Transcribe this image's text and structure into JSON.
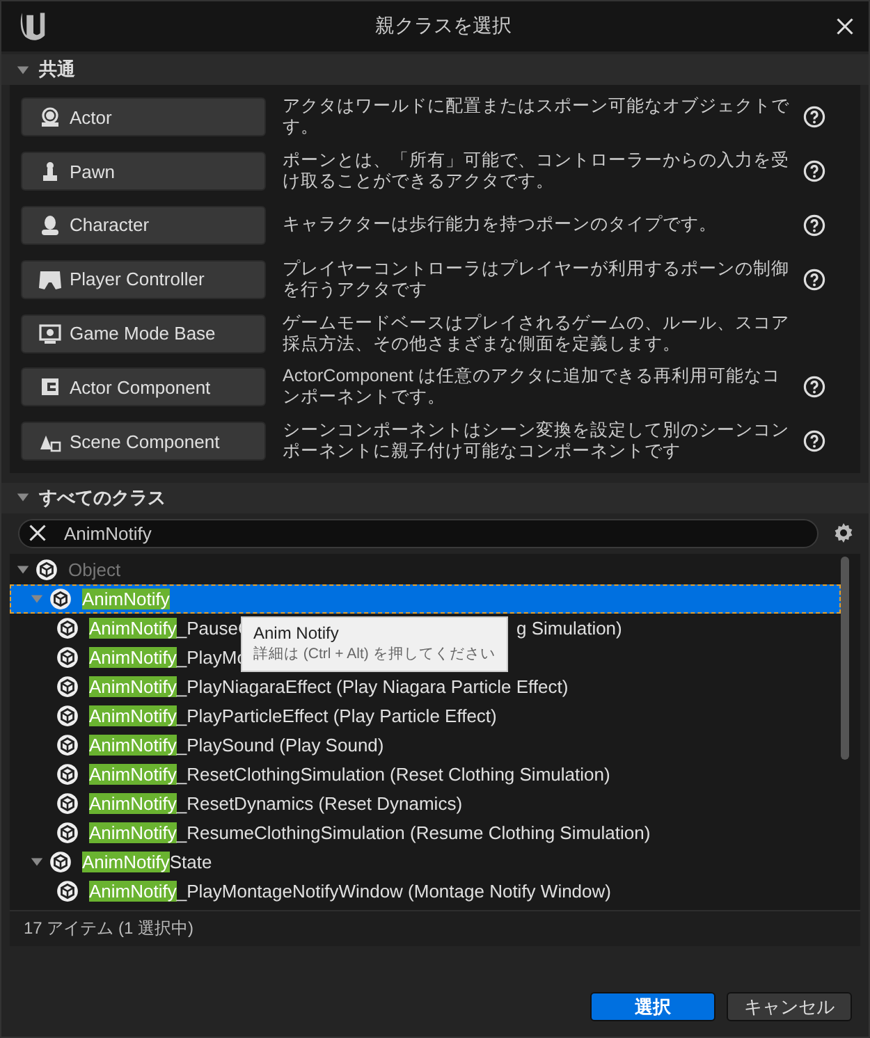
{
  "window": {
    "title": "親クラスを選択"
  },
  "common_section": {
    "title": "共通",
    "expanded": true,
    "classes": [
      {
        "label": "Actor",
        "description": "アクタはワールドに配置またはスポーン可能なオブジェクトです。",
        "help": true
      },
      {
        "label": "Pawn",
        "description": "ポーンとは、「所有」可能で、コントローラーからの入力を受け取ることができるアクタです。",
        "help": true
      },
      {
        "label": "Character",
        "description": "キャラクターは歩行能力を持つポーンのタイプです。",
        "help": true
      },
      {
        "label": "Player Controller",
        "description": "プレイヤーコントローラはプレイヤーが利用するポーンの制御を行うアクタです",
        "help": true
      },
      {
        "label": "Game Mode Base",
        "description": "ゲームモードベースはプレイされるゲームの、ルール、スコア採点方法、その他さまざまな側面を定義します。",
        "help": false
      },
      {
        "label": "Actor Component",
        "description": "ActorComponent は任意のアクタに追加できる再利用可能なコンポーネントです。",
        "help": true
      },
      {
        "label": "Scene Component",
        "description": "シーンコンポーネントはシーン変換を設定して別のシーンコンポーネントに親子付け可能なコンポーネントです",
        "help": true
      }
    ]
  },
  "all_classes_section": {
    "title": "すべてのクラス",
    "expanded": true,
    "search": {
      "value": "AnimNotify"
    },
    "tree": [
      {
        "label": "Object",
        "dimmed": true,
        "expanded": true,
        "selected": false,
        "children": [
          {
            "match": "AnimNotify",
            "dimmed": false,
            "expanded": true,
            "selected": true,
            "children": [
              {
                "match": "AnimNotify",
                "rest": "_PauseC",
                "tail": "g Simulation)",
                "dimmed": false,
                "selected": false
              },
              {
                "match": "AnimNotify",
                "rest": "_PlayMo",
                "dimmed": false,
                "selected": false
              },
              {
                "match": "AnimNotify",
                "rest": "_PlayNiagaraEffect (Play Niagara Particle Effect)",
                "dimmed": false,
                "selected": false
              },
              {
                "match": "AnimNotify",
                "rest": "_PlayParticleEffect (Play Particle Effect)",
                "dimmed": false,
                "selected": false
              },
              {
                "match": "AnimNotify",
                "rest": "_PlaySound (Play Sound)",
                "dimmed": false,
                "selected": false
              },
              {
                "match": "AnimNotify",
                "rest": "_ResetClothingSimulation (Reset Clothing Simulation)",
                "dimmed": false,
                "selected": false
              },
              {
                "match": "AnimNotify",
                "rest": "_ResetDynamics (Reset Dynamics)",
                "dimmed": false,
                "selected": false
              },
              {
                "match": "AnimNotify",
                "rest": "_ResumeClothingSimulation (Resume Clothing Simulation)",
                "dimmed": false,
                "selected": false
              }
            ]
          },
          {
            "match": "AnimNotify",
            "rest": "State",
            "dimmed": false,
            "expanded": true,
            "selected": false,
            "children": [
              {
                "match": "AnimNotify",
                "rest": "_PlayMontageNotifyWindow (Montage Notify Window)",
                "dimmed": false,
                "selected": false
              }
            ]
          }
        ]
      }
    ],
    "tooltip": {
      "title": "Anim Notify",
      "hint": "詳細は (Ctrl + Alt) を押してください"
    },
    "status": "17 アイテム (1 選択中)"
  },
  "buttons": [
    {
      "label": "選択",
      "kind": "primary"
    },
    {
      "label": "キャンセル",
      "kind": "secondary"
    }
  ]
}
